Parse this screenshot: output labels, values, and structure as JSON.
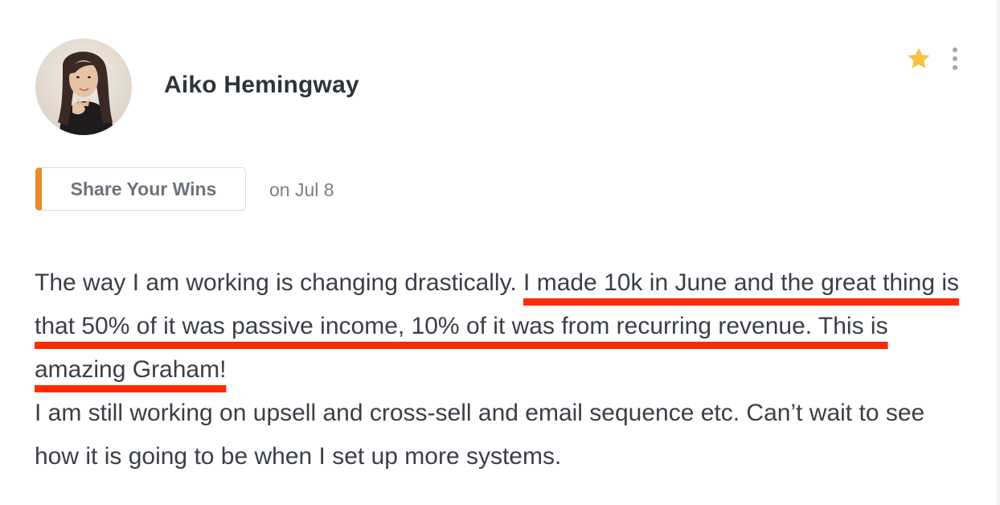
{
  "author": {
    "name": "Aiko Hemingway"
  },
  "post": {
    "category": "Share Your Wins",
    "date": "on Jul 8",
    "body": {
      "intro": "The way I am working is changing drastically. ",
      "highlight": "I made 10k in June and the great thing is that 50% of it was passive income, 10% of it was from recurring revenue. This is amazing Graham!",
      "second_paragraph": "I am still working on upsell and cross-sell and email sequence etc. Can’t wait to see how it is going to be when I set up more systems."
    }
  },
  "actions": {
    "favorite_icon": "star-icon",
    "menu_icon": "more-vertical-icon"
  },
  "colors": {
    "accent": "#e98a2c",
    "star": "#f6c243",
    "highlight_underline": "#ff2a00",
    "text": "#3a3f47"
  }
}
